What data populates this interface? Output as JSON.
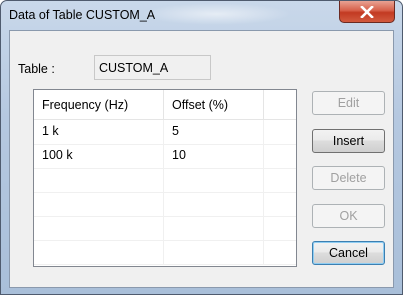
{
  "window": {
    "title": "Data of Table CUSTOM_A"
  },
  "table": {
    "label": "Table :",
    "name": "CUSTOM_A"
  },
  "grid": {
    "columns": [
      "Frequency (Hz)",
      "Offset (%)",
      ""
    ],
    "rows": [
      [
        "1 k",
        "5",
        ""
      ],
      [
        "100 k",
        "10",
        ""
      ],
      [
        "",
        "",
        ""
      ],
      [
        "",
        "",
        ""
      ],
      [
        "",
        "",
        ""
      ],
      [
        "",
        "",
        ""
      ]
    ]
  },
  "buttons": {
    "edit": "Edit",
    "insert": "Insert",
    "delete": "Delete",
    "ok": "OK",
    "cancel": "Cancel"
  },
  "icons": {
    "close": "close-icon"
  },
  "colors": {
    "close_button": "#c8452a",
    "title_glass": "#b5c8e0",
    "client_background": "#f0f0f0",
    "disabled_text": "#a0a0a0"
  }
}
